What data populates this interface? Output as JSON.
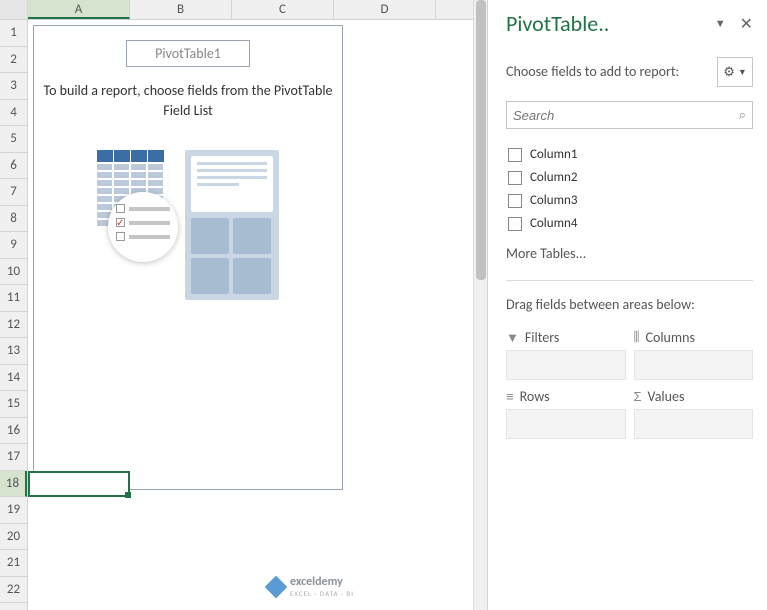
{
  "columns": [
    "A",
    "B",
    "C",
    "D"
  ],
  "rows": [
    "1",
    "2",
    "3",
    "4",
    "5",
    "6",
    "7",
    "8",
    "9",
    "10",
    "11",
    "12",
    "13",
    "14",
    "15",
    "16",
    "17",
    "18",
    "19",
    "20",
    "21",
    "22"
  ],
  "selected_column_index": 0,
  "selected_row_index": 17,
  "pivot": {
    "title": "PivotTable1",
    "instruction": "To build a report, choose fields from the PivotTable Field List"
  },
  "watermark": {
    "brand": "exceldemy",
    "tagline": "EXCEL · DATA · BI"
  },
  "taskpane": {
    "title": "PivotTable..",
    "choose_label": "Choose fields to add to report:",
    "search_placeholder": "Search",
    "fields": [
      {
        "label": "Column1",
        "checked": false
      },
      {
        "label": "Column2",
        "checked": false
      },
      {
        "label": "Column3",
        "checked": false
      },
      {
        "label": "Column4",
        "checked": false
      }
    ],
    "more_tables": "More Tables...",
    "drag_label": "Drag fields between areas below:",
    "areas": {
      "filters": "Filters",
      "columns": "Columns",
      "rows": "Rows",
      "values": "Values"
    }
  }
}
